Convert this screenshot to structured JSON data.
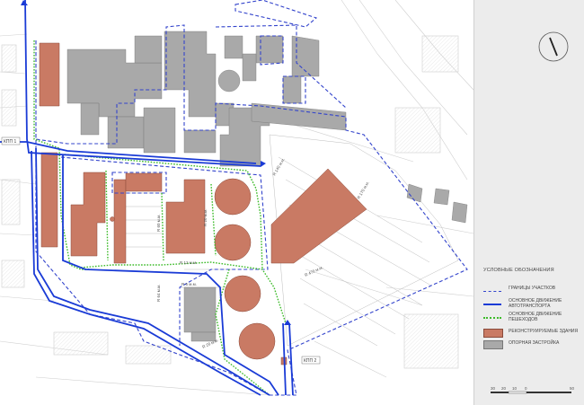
{
  "map": {
    "gate_labels": [
      "КПП 1",
      "КПП 2"
    ],
    "radius_labels": [
      "R 140 м.м.",
      "R 170 м.м.",
      "R 470 м.м.",
      "R 60 м.м.",
      "R 20 м.м.",
      "R 12 м.м.",
      "R 64 м.м.",
      "R 6 м.м.",
      "R 28 м.м."
    ]
  },
  "legend": {
    "title": "УСЛОВНЫЕ ОБОЗНАЧЕНИЯ",
    "items": [
      {
        "label": "ГРАНИЦЫ УЧАСТКОВ",
        "symbol": "dashed-blue-line"
      },
      {
        "label": "ОСНОВНОЕ ДВИЖЕНИЕ АВТОТРАНСПОРТА",
        "symbol": "solid-blue-line"
      },
      {
        "label": "ОСНОВНОЕ ДВИЖЕНИЕ ПЕШЕХОДОВ",
        "symbol": "dotted-green-line"
      },
      {
        "label": "РЕКОНСТРУИРУЕМЫЕ ЗДАНИЯ",
        "symbol": "red-fill"
      },
      {
        "label": "ОПОРНАЯ ЗАСТРОЙКА",
        "symbol": "gray-fill"
      }
    ]
  },
  "scale": {
    "ticks": [
      "30",
      "20",
      "10",
      "0",
      "50"
    ]
  },
  "colors": {
    "boundary": "#3344cc",
    "traffic": "#1a3bd6",
    "pedestrian": "#3dbb2a",
    "reconstructed": "#c97a64",
    "existing": "#a9a9a9"
  }
}
